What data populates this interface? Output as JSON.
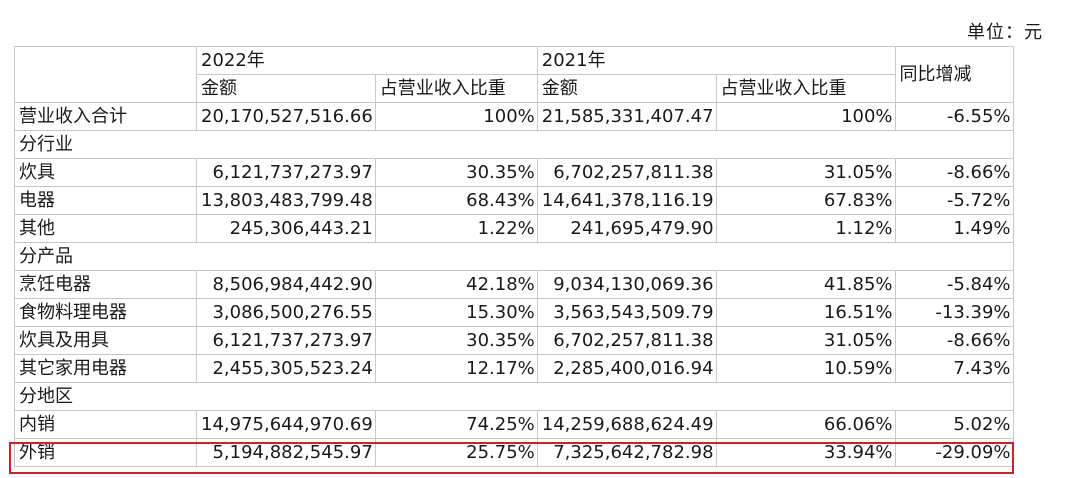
{
  "unit_label": "单位：元",
  "header": {
    "year_2022": "2022年",
    "year_2021": "2021年",
    "amount": "金额",
    "share": "占营业收入比重",
    "yoy": "同比增减"
  },
  "rows": [
    {
      "type": "data",
      "label": "营业收入合计",
      "a22": "20,170,527,516.66",
      "s22": "100%",
      "a21": "21,585,331,407.47",
      "s21": "100%",
      "yoy": "-6.55%"
    },
    {
      "type": "section",
      "label": "分行业"
    },
    {
      "type": "data",
      "label": "炊具",
      "a22": "6,121,737,273.97",
      "s22": "30.35%",
      "a21": "6,702,257,811.38",
      "s21": "31.05%",
      "yoy": "-8.66%"
    },
    {
      "type": "data",
      "label": "电器",
      "a22": "13,803,483,799.48",
      "s22": "68.43%",
      "a21": "14,641,378,116.19",
      "s21": "67.83%",
      "yoy": "-5.72%"
    },
    {
      "type": "data",
      "label": "其他",
      "a22": "245,306,443.21",
      "s22": "1.22%",
      "a21": "241,695,479.90",
      "s21": "1.12%",
      "yoy": "1.49%"
    },
    {
      "type": "section",
      "label": "分产品"
    },
    {
      "type": "data",
      "label": "烹饪电器",
      "a22": "8,506,984,442.90",
      "s22": "42.18%",
      "a21": "9,034,130,069.36",
      "s21": "41.85%",
      "yoy": "-5.84%"
    },
    {
      "type": "data",
      "label": "食物料理电器",
      "a22": "3,086,500,276.55",
      "s22": "15.30%",
      "a21": "3,563,543,509.79",
      "s21": "16.51%",
      "yoy": "-13.39%"
    },
    {
      "type": "data",
      "label": "炊具及用具",
      "a22": "6,121,737,273.97",
      "s22": "30.35%",
      "a21": "6,702,257,811.38",
      "s21": "31.05%",
      "yoy": "-8.66%"
    },
    {
      "type": "data",
      "label": "其它家用电器",
      "a22": "2,455,305,523.24",
      "s22": "12.17%",
      "a21": "2,285,400,016.94",
      "s21": "10.59%",
      "yoy": "7.43%"
    },
    {
      "type": "section",
      "label": "分地区"
    },
    {
      "type": "data",
      "label": "内销",
      "a22": "14,975,644,970.69",
      "s22": "74.25%",
      "a21": "14,259,688,624.49",
      "s21": "66.06%",
      "yoy": "5.02%"
    },
    {
      "type": "data",
      "label": "外销",
      "a22": "5,194,882,545.97",
      "s22": "25.75%",
      "a21": "7,325,642,782.98",
      "s21": "33.94%",
      "yoy": "-29.09%"
    }
  ],
  "highlight_color": "#d0202a"
}
